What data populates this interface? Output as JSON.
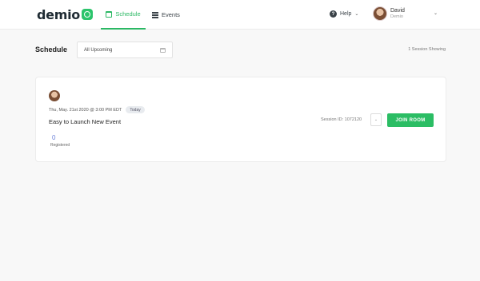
{
  "header": {
    "logo_text": "demio",
    "tabs": [
      {
        "label": "Schedule",
        "icon": "calendar-icon",
        "active": true
      },
      {
        "label": "Events",
        "icon": "list-icon",
        "active": false
      }
    ],
    "help_label": "Help",
    "user": {
      "name": "David",
      "org": "Demio"
    }
  },
  "toolbar": {
    "title": "Schedule",
    "filter_value": "All Upcoming",
    "sessions_showing": "1 Session Showing"
  },
  "session": {
    "date": "Thu, May. 21st 2020 @ 3:00 PM EDT",
    "badge": "Today",
    "title": "Easy to Launch New Event",
    "registered_count": "0",
    "registered_label": "Registered",
    "session_id": "Session ID: 1072120",
    "join_label": "JOIN ROOM"
  },
  "colors": {
    "accent_green": "#2bbd64",
    "link_blue": "#6a7fd8"
  }
}
